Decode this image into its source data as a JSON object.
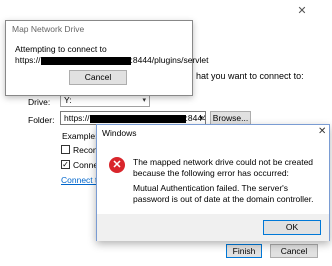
{
  "wizard": {
    "close_glyph": "✕",
    "partial_text": "hat you want to connect to:",
    "drive_label": "Drive:",
    "drive_value": "Y:",
    "folder_label": "Folder:",
    "folder_prefix": "https://",
    "folder_suffix": ":8444/j",
    "browse_label": "Browse...",
    "example_label": "Example: \\\\s",
    "reconnect_label": "Reconnec",
    "connect_label": "Connect",
    "reconnect_checked": false,
    "connect_checked": true,
    "link_label": "Connect to a",
    "finish_label": "Finish",
    "cancel_label": "Cancel"
  },
  "connecting_dialog": {
    "title": "Map Network Drive",
    "message": "Attempting to connect to",
    "url_prefix": "https://",
    "url_suffix": ":8444/plugins/servlet",
    "cancel_label": "Cancel"
  },
  "error_dialog": {
    "title": "Windows",
    "close_glyph": "✕",
    "icon": "error-icon",
    "message": "The mapped network drive could not be created because the following error has occurred:",
    "detail": "Mutual Authentication failed. The server's password is out of date at the domain controller.",
    "ok_label": "OK"
  },
  "colors": {
    "accent": "#0078d7",
    "error_red": "#d9262c",
    "link": "#0066cc"
  }
}
